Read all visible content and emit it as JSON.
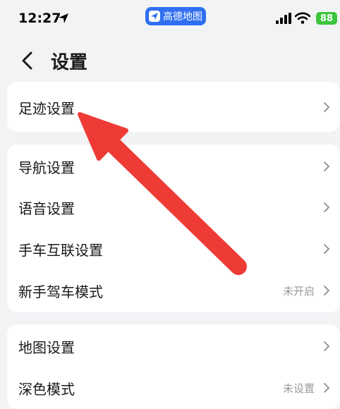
{
  "status_bar": {
    "time": "12:27",
    "app_name": "高德地图",
    "battery": "88"
  },
  "header": {
    "title": "设置"
  },
  "groups": [
    {
      "items": [
        {
          "label": "足迹设置",
          "value": ""
        }
      ]
    },
    {
      "items": [
        {
          "label": "导航设置",
          "value": ""
        },
        {
          "label": "语音设置",
          "value": ""
        },
        {
          "label": "手车互联设置",
          "value": ""
        },
        {
          "label": "新手驾车模式",
          "value": "未开启"
        }
      ]
    },
    {
      "items": [
        {
          "label": "地图设置",
          "value": ""
        },
        {
          "label": "深色模式",
          "value": "未设置"
        }
      ]
    }
  ],
  "colors": {
    "annotation_arrow": "#ee3b36",
    "app_pill": "#2f6ff0",
    "battery": "#3cc63c"
  }
}
